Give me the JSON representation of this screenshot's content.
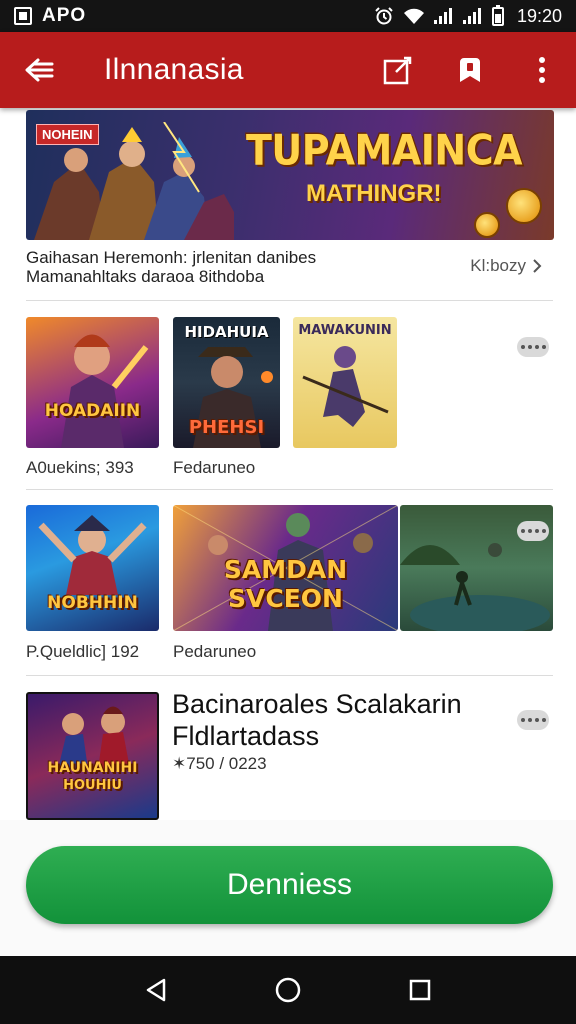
{
  "status_bar": {
    "carrier": "APO",
    "time": "19:20",
    "icons": [
      "app-badge-icon",
      "alarm-icon",
      "wifi-icon",
      "signal-icon",
      "signal-icon",
      "battery-icon"
    ]
  },
  "app_bar": {
    "title": "Ilnnanasia",
    "icons": [
      "back-arrow-icon",
      "edit-icon",
      "bookmark-icon",
      "more-vert-icon"
    ]
  },
  "banner": {
    "tag": "NOHEIN",
    "headline": "TUPAMAINCA",
    "subheadline": "MATHINGR!",
    "description_line1": "Gaihasan Heremonh: jrlenitan danibes",
    "description_line2": "Mamanahltaks daraoa 8ithdoba",
    "more_label": "Kl:bozy"
  },
  "row1": {
    "tiles": [
      {
        "art_text": "HOADAIIN",
        "caption": "A0uekins; 393"
      },
      {
        "art_text_top": "HIDAHUIA",
        "art_text_bottom": "PHEHSI",
        "caption": "Fedaruneo"
      },
      {
        "art_text_top": "MAWAKUNIN"
      }
    ]
  },
  "row2": {
    "tiles": [
      {
        "art_text": "NOBHHIN",
        "caption": "P.Queldlic] 192"
      },
      {
        "art_text": "SAMDAN SVCEON",
        "caption": "Pedaruneo"
      },
      {}
    ]
  },
  "row3": {
    "tile": {
      "art_text_top": "HAUNANIHI",
      "art_text_bottom": "HOUHIU"
    },
    "title_line1": "Bacinaroales Scalakarin",
    "title_line2": "Fldlartadass",
    "stat": "✶750 / 0223"
  },
  "cta": {
    "label": "Denniess"
  },
  "nav_bar": {
    "icons": [
      "back-triangle-icon",
      "home-circle-icon",
      "recents-square-icon"
    ]
  },
  "colors": {
    "app_bar": "#b71c1c",
    "cta": "#1a9b40",
    "status_bar": "#141414"
  }
}
